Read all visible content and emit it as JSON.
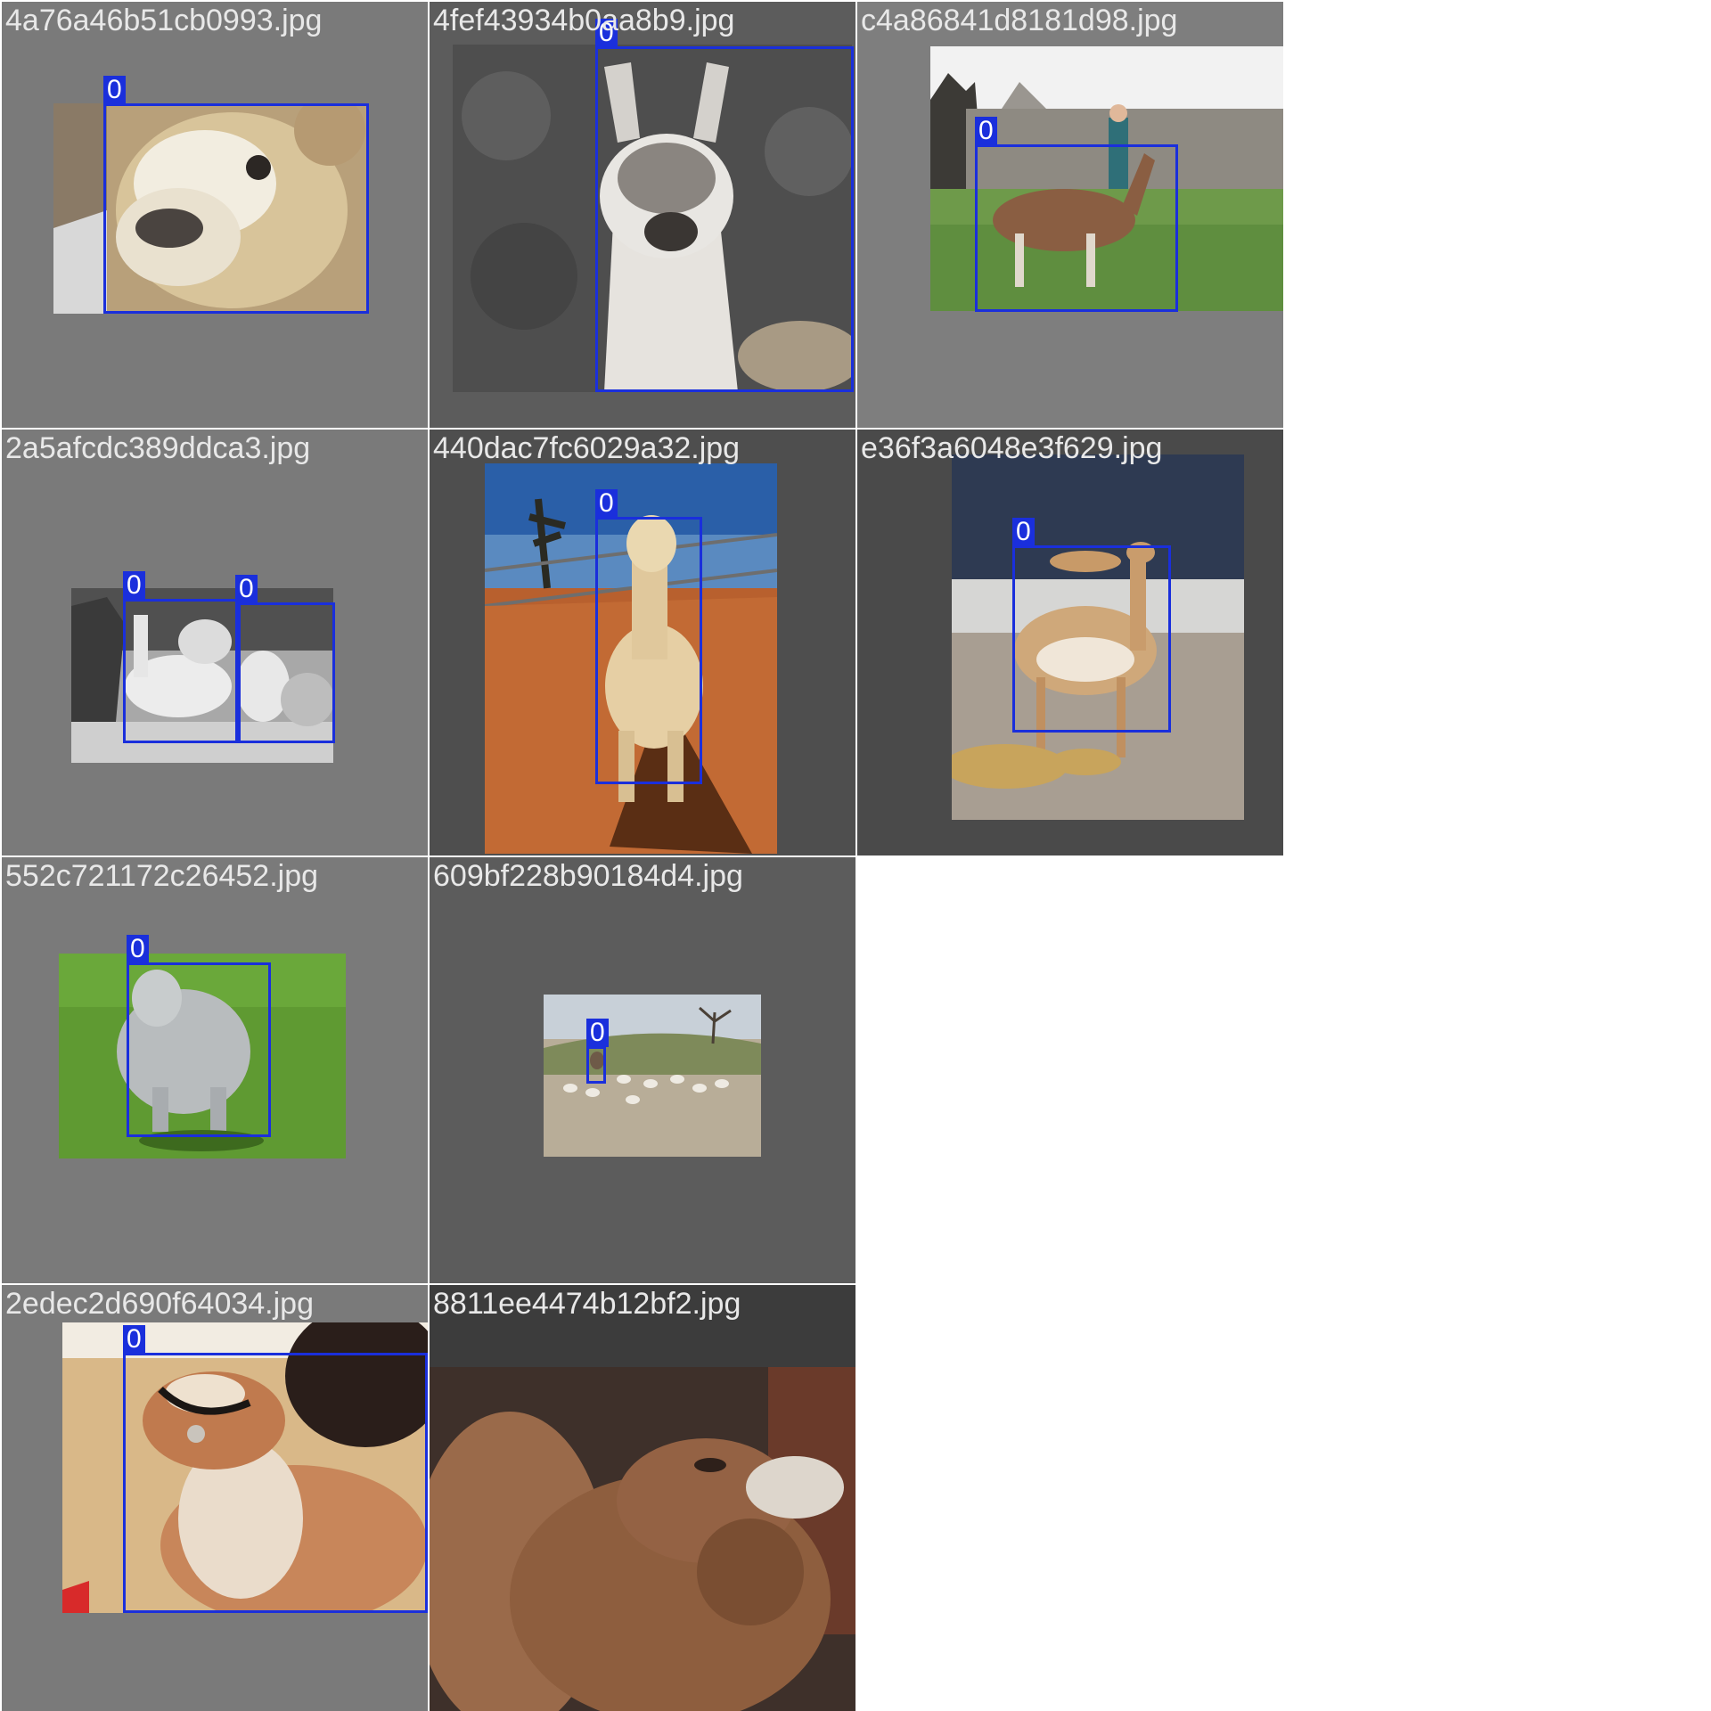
{
  "grid": {
    "tiles": [
      {
        "filename": "4a76a46b51cb0993.jpg",
        "background": "#7a7a7a",
        "boxes": [
          {
            "label": "0"
          }
        ]
      },
      {
        "filename": "4fef43934b0aa8b9.jpg",
        "background": "#5c5c5c",
        "boxes": [
          {
            "label": "0"
          }
        ]
      },
      {
        "filename": "c4a86841d8181d98.jpg",
        "background": "#7e7e7e",
        "boxes": [
          {
            "label": "0"
          }
        ]
      },
      {
        "filename": "2a5afcdc389ddca3.jpg",
        "background": "#7a7a7a",
        "boxes": [
          {
            "label": "0"
          },
          {
            "label": "0"
          }
        ]
      },
      {
        "filename": "440dac7fc6029a32.jpg",
        "background": "#4e4e4e",
        "boxes": [
          {
            "label": "0"
          }
        ]
      },
      {
        "filename": "e36f3a6048e3f629.jpg",
        "background": "#4a4a4a",
        "boxes": [
          {
            "label": "0"
          }
        ]
      },
      {
        "filename": "552c721172c26452.jpg",
        "background": "#7a7a7a",
        "boxes": [
          {
            "label": "0"
          }
        ]
      },
      {
        "filename": "609bf228b90184d4.jpg",
        "background": "#5c5c5c",
        "boxes": [
          {
            "label": "0"
          }
        ]
      },
      {
        "filename": "2edec2d690f64034.jpg",
        "background": "#7a7a7a",
        "boxes": [
          {
            "label": "0"
          }
        ]
      },
      {
        "filename": "8811ee4474b12bf2.jpg",
        "background": "#3c3c3c",
        "boxes": []
      }
    ]
  },
  "colors": {
    "box": "#1a2fdc",
    "filename_text": "#e8e8e8"
  }
}
